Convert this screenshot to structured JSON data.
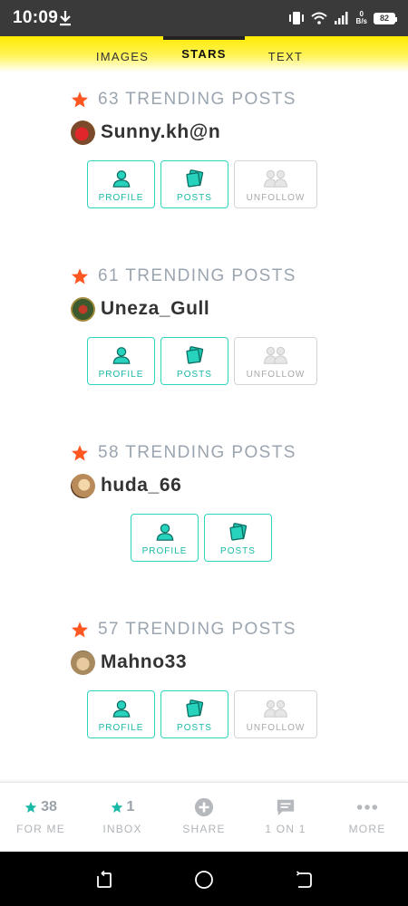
{
  "status": {
    "time": "10:09",
    "net_speed_value": "0",
    "net_speed_unit": "B/s",
    "battery": "82"
  },
  "tabs": [
    {
      "label": "IMAGES"
    },
    {
      "label": "STARS",
      "active": true
    },
    {
      "label": "TEXT"
    }
  ],
  "cards": [
    {
      "trending": "63 TRENDING POSTS",
      "username": "Sunny.kh@n",
      "avatar_color": "#7a4a2a",
      "buttons": [
        "PROFILE",
        "POSTS",
        "UNFOLLOW"
      ]
    },
    {
      "trending": "61 TRENDING POSTS",
      "username": "Uneza_Gull",
      "avatar_color": "#3d5a2f",
      "buttons": [
        "PROFILE",
        "POSTS",
        "UNFOLLOW"
      ]
    },
    {
      "trending": "58 TRENDING POSTS",
      "username": "huda_66",
      "avatar_color": "#b98b5a",
      "buttons": [
        "PROFILE",
        "POSTS"
      ]
    },
    {
      "trending": "57 TRENDING POSTS",
      "username": "Mahno33",
      "avatar_color": "#a88a5f",
      "buttons": [
        "PROFILE",
        "POSTS",
        "UNFOLLOW"
      ]
    }
  ],
  "bottom_nav": [
    {
      "count": "38",
      "label": "FOR ME",
      "icon": "star-icon"
    },
    {
      "count": "1",
      "label": "INBOX",
      "icon": "star-icon"
    },
    {
      "count": "",
      "label": "SHARE",
      "icon": "plus-circle-icon"
    },
    {
      "count": "",
      "label": "1 ON 1",
      "icon": "chat-icon"
    },
    {
      "count": "",
      "label": "MORE",
      "icon": "more-dots-icon"
    }
  ],
  "colors": {
    "accent": "#2ed6bf",
    "accent_text": "#19b9a8",
    "star": "#ff5722",
    "tab_bar": "#ffea00"
  }
}
